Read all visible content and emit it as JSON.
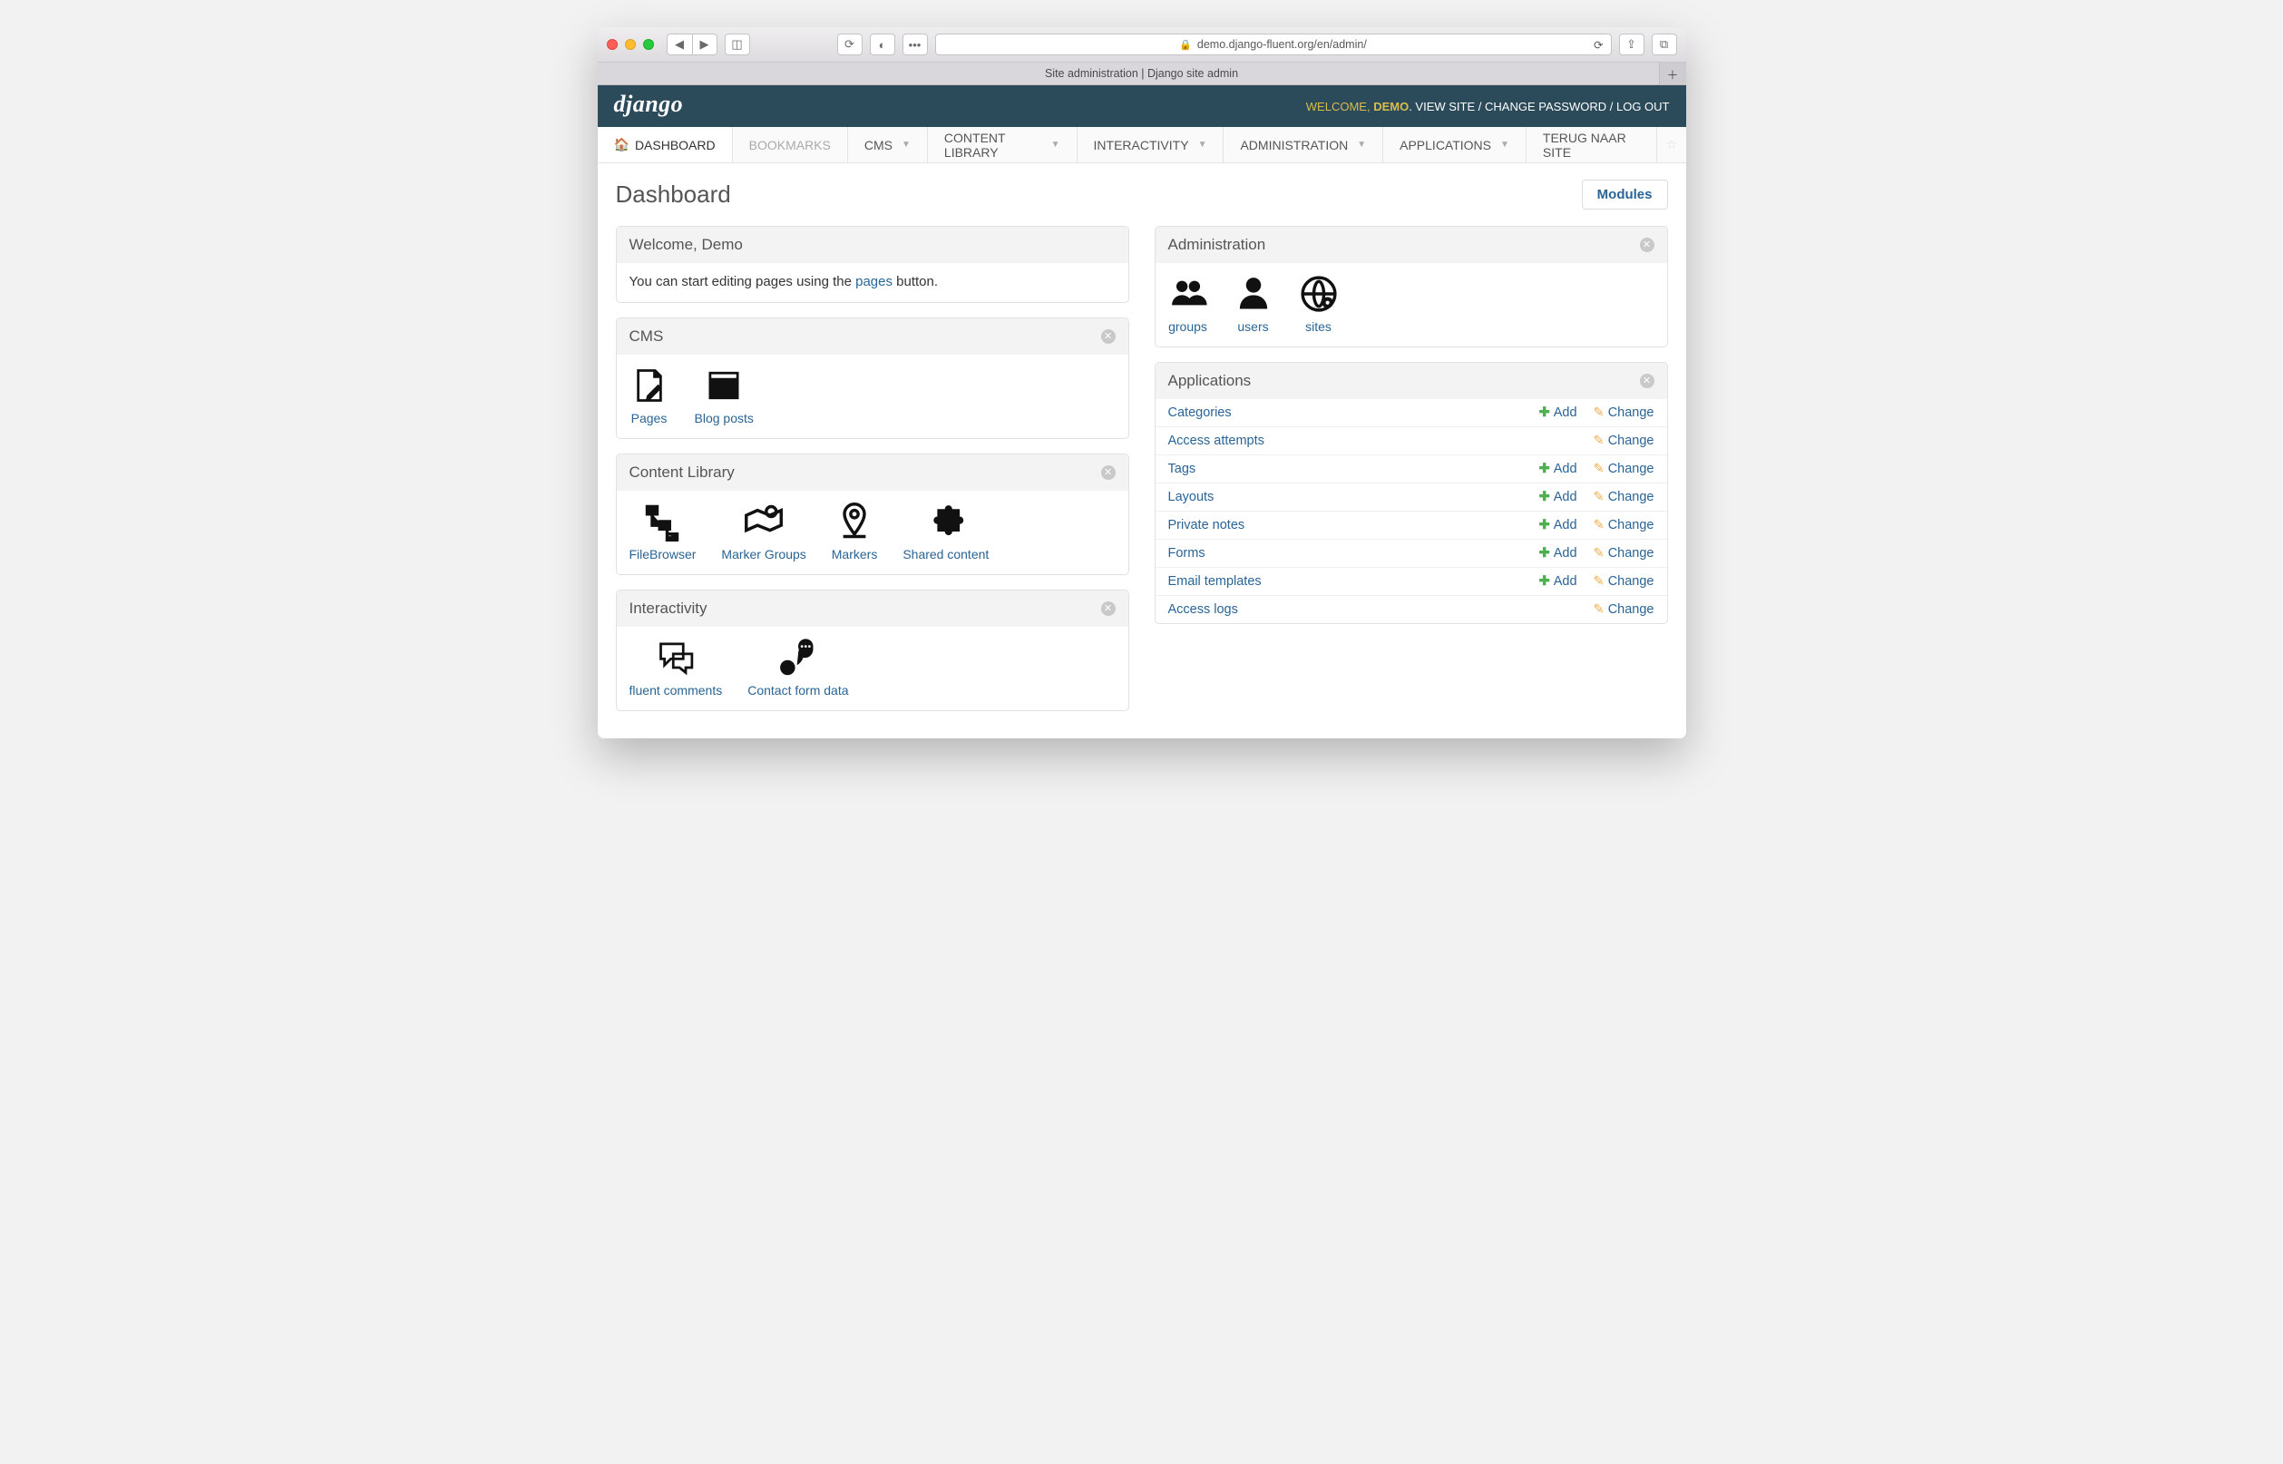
{
  "browser": {
    "url_display": "demo.django-fluent.org/en/admin/",
    "tab_title": "Site administration | Django site admin"
  },
  "header": {
    "logo_text": "django",
    "welcome_prefix": "WELCOME, ",
    "welcome_user": "DEMO",
    "links": {
      "view_site": "VIEW SITE",
      "change_password": "CHANGE PASSWORD",
      "logout": "LOG OUT"
    }
  },
  "nav": {
    "dashboard": "DASHBOARD",
    "bookmarks": "BOOKMARKS",
    "cms": "CMS",
    "content_library": "CONTENT LIBRARY",
    "interactivity": "INTERACTIVITY",
    "administration": "ADMINISTRATION",
    "applications": "APPLICATIONS",
    "back_to_site": "TERUG NAAR SITE"
  },
  "page": {
    "title": "Dashboard",
    "modules_button": "Modules"
  },
  "welcome_panel": {
    "title": "Welcome, Demo",
    "text_before": "You can start editing pages using the ",
    "link_text": "pages",
    "text_after": " button."
  },
  "cms_panel": {
    "title": "CMS",
    "items": [
      {
        "label": "Pages",
        "icon": "edit-doc"
      },
      {
        "label": "Blog posts",
        "icon": "news"
      }
    ]
  },
  "content_library_panel": {
    "title": "Content Library",
    "items": [
      {
        "label": "FileBrowser",
        "icon": "tree"
      },
      {
        "label": "Marker Groups",
        "icon": "map"
      },
      {
        "label": "Markers",
        "icon": "pin"
      },
      {
        "label": "Shared content",
        "icon": "puzzle"
      }
    ]
  },
  "interactivity_panel": {
    "title": "Interactivity",
    "items": [
      {
        "label": "fluent comments",
        "icon": "comments"
      },
      {
        "label": "Contact form data",
        "icon": "speak"
      }
    ]
  },
  "administration_panel": {
    "title": "Administration",
    "items": [
      {
        "label": "groups",
        "icon": "groups"
      },
      {
        "label": "users",
        "icon": "user"
      },
      {
        "label": "sites",
        "icon": "globe-gear"
      }
    ]
  },
  "applications_panel": {
    "title": "Applications",
    "add_label": "Add",
    "change_label": "Change",
    "rows": [
      {
        "name": "Categories",
        "add": true,
        "change": true
      },
      {
        "name": "Access attempts",
        "add": false,
        "change": true
      },
      {
        "name": "Tags",
        "add": true,
        "change": true
      },
      {
        "name": "Layouts",
        "add": true,
        "change": true
      },
      {
        "name": "Private notes",
        "add": true,
        "change": true
      },
      {
        "name": "Forms",
        "add": true,
        "change": true
      },
      {
        "name": "Email templates",
        "add": true,
        "change": true
      },
      {
        "name": "Access logs",
        "add": false,
        "change": true
      }
    ]
  }
}
